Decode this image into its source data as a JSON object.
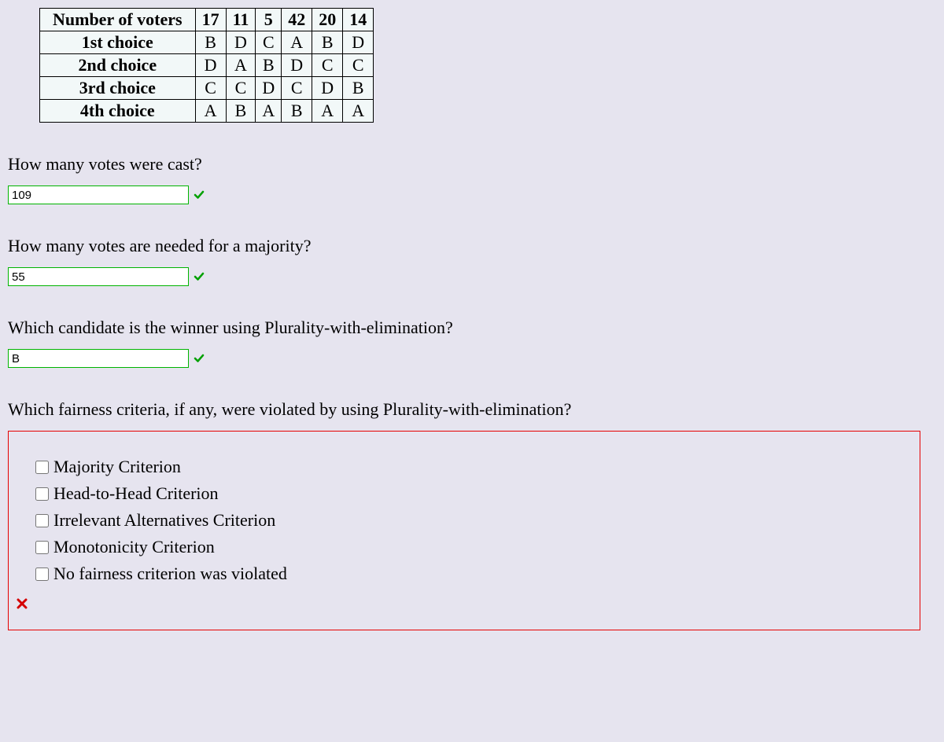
{
  "table": {
    "header": [
      "Number of voters",
      "17",
      "11",
      "5",
      "42",
      "20",
      "14"
    ],
    "rows": [
      [
        "1st choice",
        "B",
        "D",
        "C",
        "A",
        "B",
        "D"
      ],
      [
        "2nd choice",
        "D",
        "A",
        "B",
        "D",
        "C",
        "C"
      ],
      [
        "3rd choice",
        "C",
        "C",
        "D",
        "C",
        "D",
        "B"
      ],
      [
        "4th choice",
        "A",
        "B",
        "A",
        "B",
        "A",
        "A"
      ]
    ]
  },
  "q1": {
    "text": "How many votes were cast?",
    "value": "109",
    "correct": true
  },
  "q2": {
    "text": "How many votes are needed for a majority?",
    "value": "55",
    "correct": true
  },
  "q3": {
    "text": "Which candidate is the winner using Plurality-with-elimination?",
    "value": "B",
    "correct": true
  },
  "q4": {
    "text": "Which fairness criteria, if any, were violated by using Plurality-with-elimination?",
    "options": [
      "Majority Criterion",
      "Head-to-Head Criterion",
      "Irrelevant Alternatives Criterion",
      "Monotonicity Criterion",
      "No fairness criterion was violated"
    ],
    "correct": false
  }
}
